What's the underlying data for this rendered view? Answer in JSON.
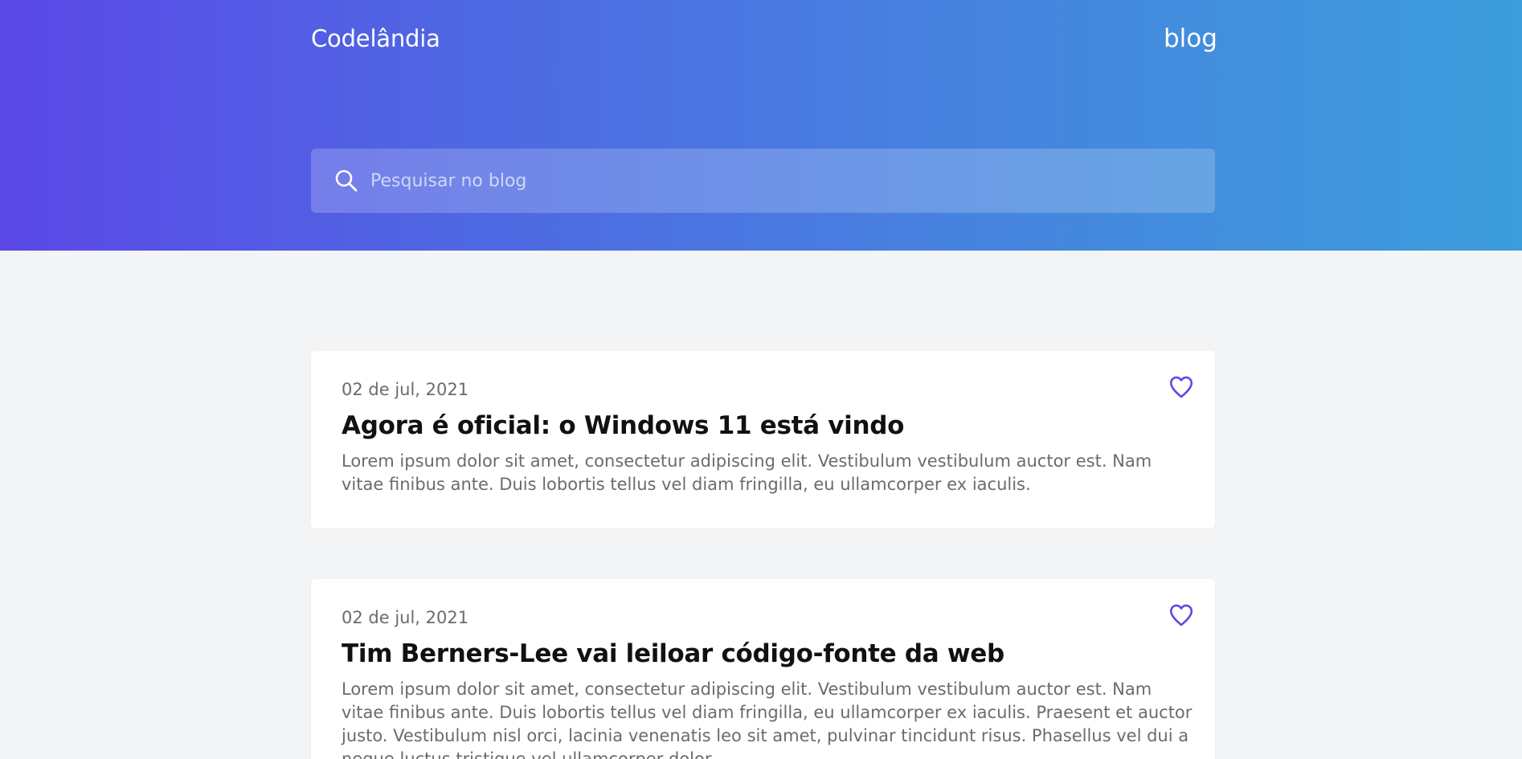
{
  "header": {
    "brand": "Codelândia",
    "nav_link": "blog"
  },
  "search": {
    "placeholder": "Pesquisar no blog",
    "icon": "search-icon"
  },
  "posts": [
    {
      "date": "02 de jul, 2021",
      "title": "Agora é oficial: o Windows 11 está vindo",
      "excerpt": "Lorem ipsum dolor sit amet, consectetur adipiscing elit. Vestibulum vestibulum auctor est. Nam vitae finibus ante. Duis lobortis tellus vel diam fringilla, eu ullamcorper ex iaculis.",
      "like_icon": "heart-icon"
    },
    {
      "date": "02 de jul, 2021",
      "title": "Tim Berners-Lee vai leiloar código-fonte da web",
      "excerpt": "Lorem ipsum dolor sit amet, consectetur adipiscing elit. Vestibulum vestibulum auctor est. Nam vitae finibus ante. Duis lobortis tellus vel diam fringilla, eu ullamcorper ex iaculis. Praesent et auctor justo. Vestibulum nisl orci, lacinia venenatis leo sit amet, pulvinar tincidunt risus. Phasellus vel dui a neque luctus tristique vel ullamcorper dolor.",
      "like_icon": "heart-icon"
    }
  ],
  "colors": {
    "accent": "#5b48e7",
    "gradient_start": "#5b48e7",
    "gradient_end": "#3c9ddb",
    "page_background": "#f3f4f6"
  }
}
